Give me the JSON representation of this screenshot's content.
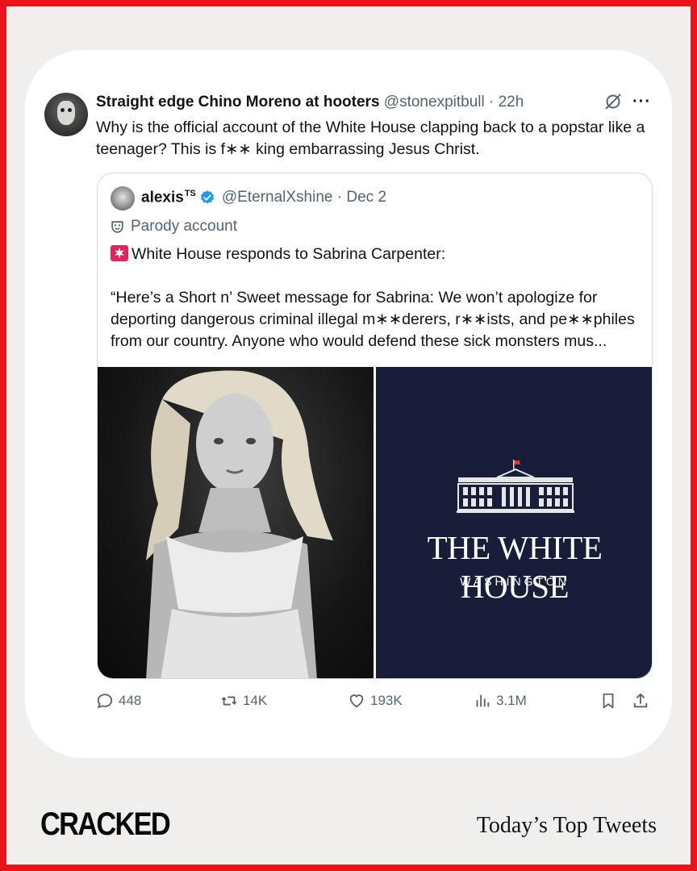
{
  "tweet": {
    "display_name": "Straight edge Chino Moreno at hooters",
    "handle": "@stonexpitbull",
    "time": "22h",
    "text": "Why is the official account of the White House clapping back to a popstar like a teenager? This is f∗∗ king embarrassing Jesus Christ."
  },
  "quote": {
    "display_name": "alexis",
    "name_suffix": "TS",
    "handle": "@EternalXshine",
    "date": "Dec 2",
    "label": "Parody account",
    "line1": "White House responds to Sabrina Carpenter:",
    "line2": "“Here’s a Short n’ Sweet message for Sabrina: We won’t apologize for deporting dangerous criminal illegal m∗∗derers, r∗∗ists, and pe∗∗philes from our country. Anyone who would defend these sick monsters mus...",
    "image_right_title": "THE WHITE HOUSE",
    "image_right_subtitle": "WASHINGTON"
  },
  "actions": {
    "replies": "448",
    "reposts": "14K",
    "likes": "193K",
    "views": "3.1M"
  },
  "footer": {
    "brand": "CRACKED",
    "tagline": "Today’s Top Tweets"
  },
  "colors": {
    "frame": "#e8141a",
    "background": "#f0efed",
    "verified": "#1d9bf0",
    "muted_text": "#536471",
    "wh_navy": "#181d3a"
  }
}
